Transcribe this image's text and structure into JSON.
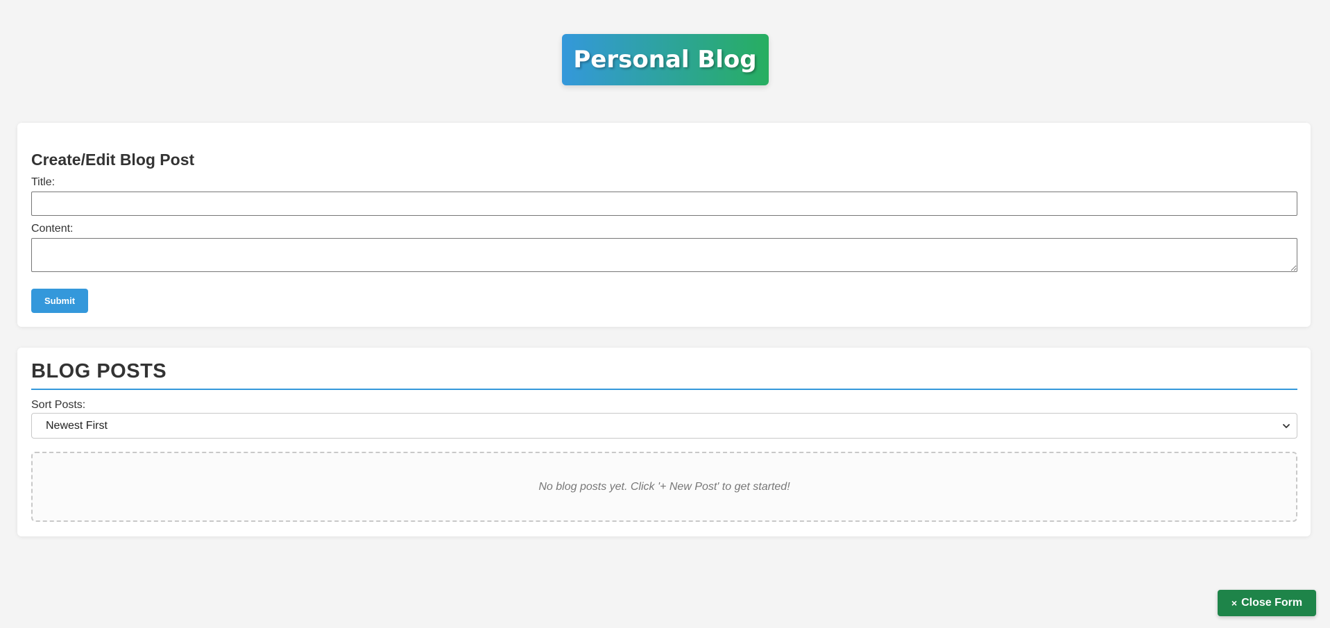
{
  "header": {
    "title": "Personal Blog",
    "gradient_start": "#3498db",
    "gradient_end": "#27ae60"
  },
  "form": {
    "heading": "Create/Edit Blog Post",
    "title_label": "Title:",
    "title_value": "",
    "content_label": "Content:",
    "content_value": "",
    "submit_label": "Submit",
    "accent_color": "#3498db"
  },
  "posts": {
    "heading": "BLOG POSTS",
    "sort_label": "Sort Posts:",
    "sort_selected": "Newest First",
    "empty_message": "No blog posts yet. Click '+ New Post' to get started!"
  },
  "floating": {
    "close_icon": "×",
    "close_label": "Close Form",
    "color": "#1e8449"
  }
}
